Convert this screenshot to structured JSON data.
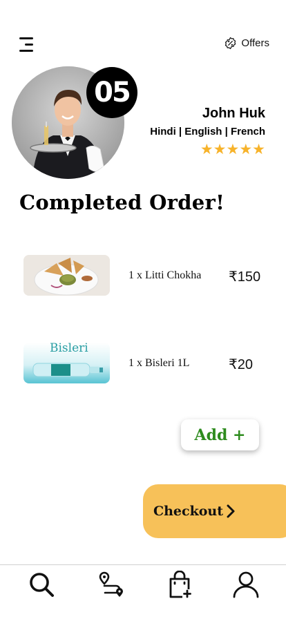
{
  "header": {
    "menu_icon": "hamburger-menu-icon",
    "offers_icon": "percent-badge-icon",
    "offers_label": "Offers"
  },
  "driver": {
    "order_number": "05",
    "name": "John Huk",
    "languages": "Hindi | English | French",
    "rating_stars": "★★★★★",
    "rating": 5,
    "star_color": "#f7b32b"
  },
  "page": {
    "title": "Completed Order!"
  },
  "order_items": [
    {
      "quantity_name": "1 x  Litti Chokha",
      "price": "₹150",
      "image": "litti-chokha-plate"
    },
    {
      "quantity_name": "1 x  Bisleri 1L",
      "price": "₹20",
      "image": "bisleri-bottle",
      "image_text": "Bisleri"
    }
  ],
  "actions": {
    "add_label": "Add +",
    "add_color": "#2e8b1e",
    "checkout_label": "Checkout",
    "checkout_icon": "chevron-right-icon",
    "checkout_color": "#f7c159"
  },
  "bottom_nav": [
    {
      "icon": "search-icon"
    },
    {
      "icon": "route-icon"
    },
    {
      "icon": "shopping-bag-add-icon"
    },
    {
      "icon": "user-icon"
    }
  ]
}
